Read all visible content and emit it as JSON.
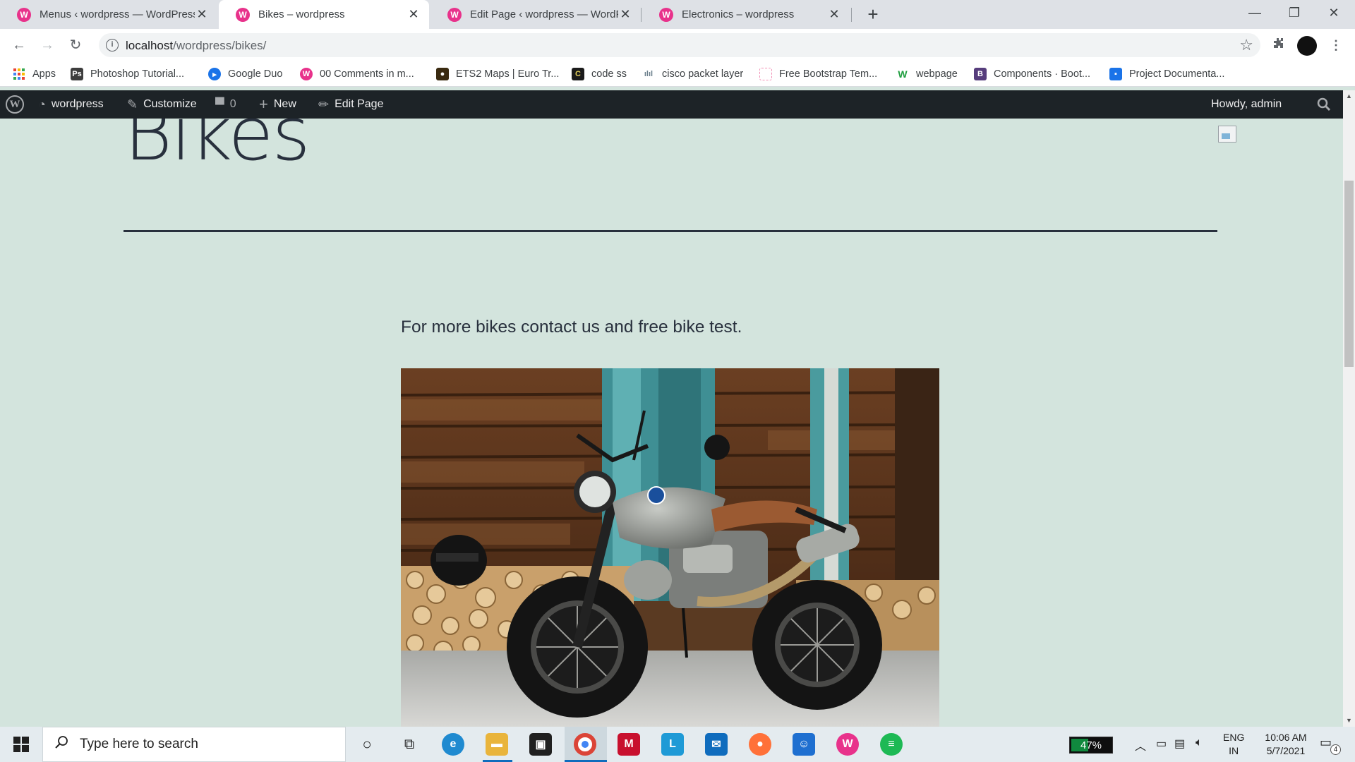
{
  "browser": {
    "tabs": [
      {
        "title": "Menus ‹ wordpress — WordPress",
        "favicon": "wampserver-icon"
      },
      {
        "title": "Bikes – wordpress",
        "favicon": "wampserver-icon",
        "active": true
      },
      {
        "title": "Edit Page ‹ wordpress — WordPress",
        "favicon": "wampserver-icon"
      },
      {
        "title": "Electronics – wordpress",
        "favicon": "wampserver-icon"
      }
    ],
    "url_host": "localhost",
    "url_path": "/wordpress/bikes/",
    "bookmarks": [
      {
        "label": "Apps",
        "icon": "apps-grid-icon",
        "color": "#ea4335"
      },
      {
        "label": "Photoshop Tutorial...",
        "icon": "photoshop-icon",
        "color": "#3d3d3d"
      },
      {
        "label": "Google Duo",
        "icon": "duo-icon",
        "color": "#1a73e8"
      },
      {
        "label": "00 Comments in m...",
        "icon": "wampserver-icon",
        "color": "#e8328b"
      },
      {
        "label": "ETS2 Maps | Euro Tr...",
        "icon": "ets2-icon",
        "color": "#3a2a10"
      },
      {
        "label": "code ss",
        "icon": "codess-icon",
        "color": "#1b1b1b"
      },
      {
        "label": "cisco packet layer",
        "icon": "cisco-icon",
        "color": "#6b7f8c"
      },
      {
        "label": "Free Bootstrap Tem...",
        "icon": "bootstrap-template-icon",
        "color": "#f28fb5"
      },
      {
        "label": "webpage",
        "icon": "wix-icon",
        "color": "#1f9d3f"
      },
      {
        "label": "Components · Boot...",
        "icon": "bootstrap-icon",
        "color": "#563d7c"
      },
      {
        "label": "Project Documenta...",
        "icon": "project-doc-icon",
        "color": "#1a73e8"
      }
    ]
  },
  "adminbar": {
    "site": "wordpress",
    "customize": "Customize",
    "comments": "0",
    "new": "New",
    "edit": "Edit Page",
    "howdy": "Howdy, admin"
  },
  "page": {
    "title": "Bikes",
    "intro": "For more bikes contact us and free bike test."
  },
  "taskbar": {
    "search_placeholder": "Type here to search",
    "battery": "47%",
    "battery_level": 0.47,
    "lang1": "ENG",
    "lang2": "IN",
    "time": "10:06 AM",
    "date": "5/7/2021",
    "notifications": "4"
  },
  "colors": {
    "page_bg": "#d3e4dd",
    "adminbar_bg": "#1d2327",
    "wamp_pink": "#e8328b"
  }
}
